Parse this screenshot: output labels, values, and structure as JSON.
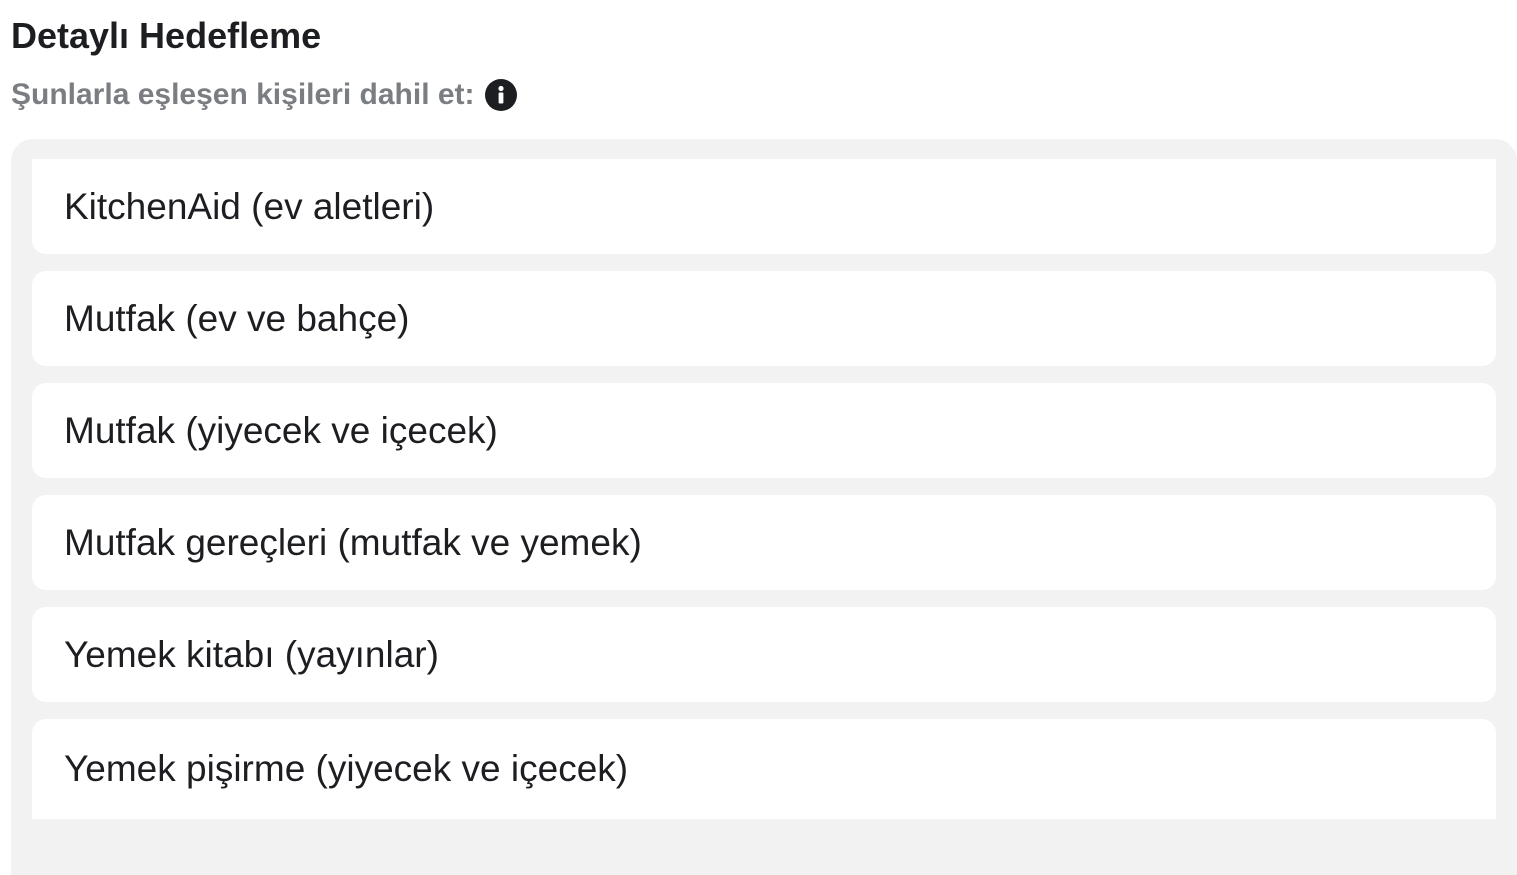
{
  "section": {
    "title": "Detaylı Hedefleme",
    "subtitle": "Şunlarla eşleşen kişileri dahil et:",
    "info_icon": "info-icon"
  },
  "targets": [
    {
      "label": "KitchenAid (ev aletleri)"
    },
    {
      "label": "Mutfak (ev ve bahçe)"
    },
    {
      "label": "Mutfak (yiyecek ve içecek)"
    },
    {
      "label": "Mutfak gereçleri (mutfak ve yemek)"
    },
    {
      "label": "Yemek kitabı (yayınlar)"
    },
    {
      "label": "Yemek pişirme (yiyecek ve içecek)"
    }
  ],
  "colors": {
    "title": "#1c1e21",
    "subtitle": "#7a7d82",
    "panel_background": "#f2f2f2",
    "item_background": "#ffffff"
  }
}
